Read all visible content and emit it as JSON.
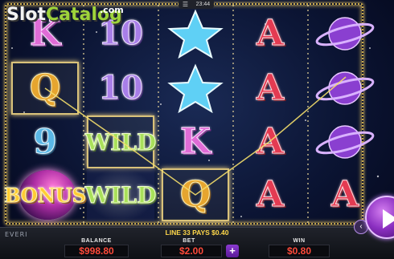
{
  "watermark": {
    "part1": "Slot",
    "part2": "Catalog",
    "suffix": ".com"
  },
  "top_menu": {
    "icon": "menu-icon",
    "time": "23:44"
  },
  "reels": [
    [
      "K",
      "Q",
      "9",
      "BONUS"
    ],
    [
      "10",
      "10",
      "WILD",
      "WILD"
    ],
    [
      "STAR",
      "STAR",
      "K",
      "Q"
    ],
    [
      "A",
      "A",
      "A",
      "A"
    ],
    [
      "PLANET",
      "PLANET",
      "PLANET",
      "A"
    ]
  ],
  "winning_line": {
    "number": 33,
    "message": "LINE 33 PAYS $0.40"
  },
  "footer": {
    "brand": "EVERI",
    "balance_label": "BALANCE",
    "balance_value": "$998.80",
    "bet_label": "BET",
    "bet_value": "$2.00",
    "bet_increase": "+",
    "win_label": "WIN",
    "win_value": "$0.80"
  },
  "colors": {
    "accent": "#ffd84a",
    "money": "#ff4a3a",
    "spin": "#8a2fc0",
    "frame": "#c9a94a"
  }
}
